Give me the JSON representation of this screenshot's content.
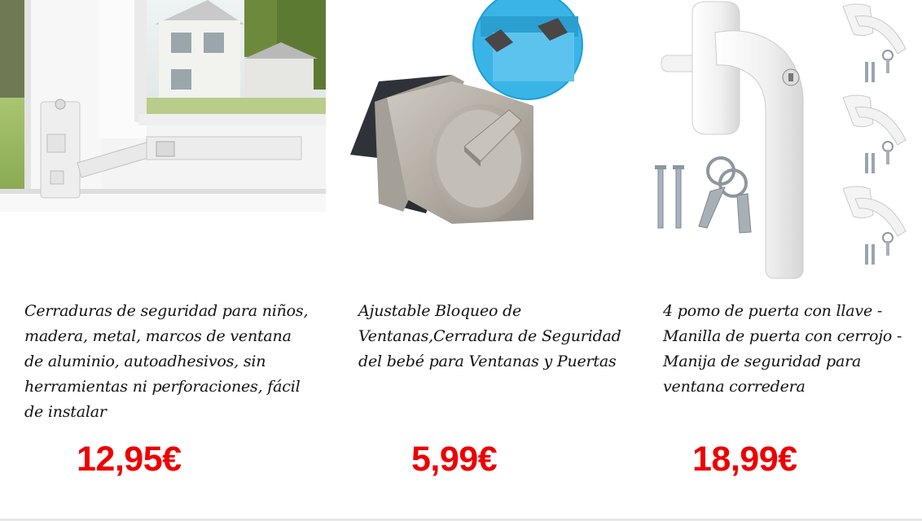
{
  "products": [
    {
      "image": "window-lock-strap-photo",
      "title": "Cerraduras de seguridad para niños, madera, metal, marcos de ventana de aluminio, autoadhesivos, sin herramientas ni perforaciones, fácil de instalar",
      "price": "12,95€"
    },
    {
      "image": "sliding-window-lock-photo",
      "title": "Ajustable Bloqueo de Ventanas,Cerradura de Seguridad del bebé para Ventanas y Puertas",
      "price": "5,99€"
    },
    {
      "image": "window-handle-with-key-photo",
      "title": "4 pomo de puerta con llave - Manilla de puerta con cerrojo - Manija de seguridad para ventana corredera",
      "price": "18,99€"
    }
  ],
  "colors": {
    "price": "#ee0000",
    "title": "#111111",
    "background": "#ffffff"
  }
}
